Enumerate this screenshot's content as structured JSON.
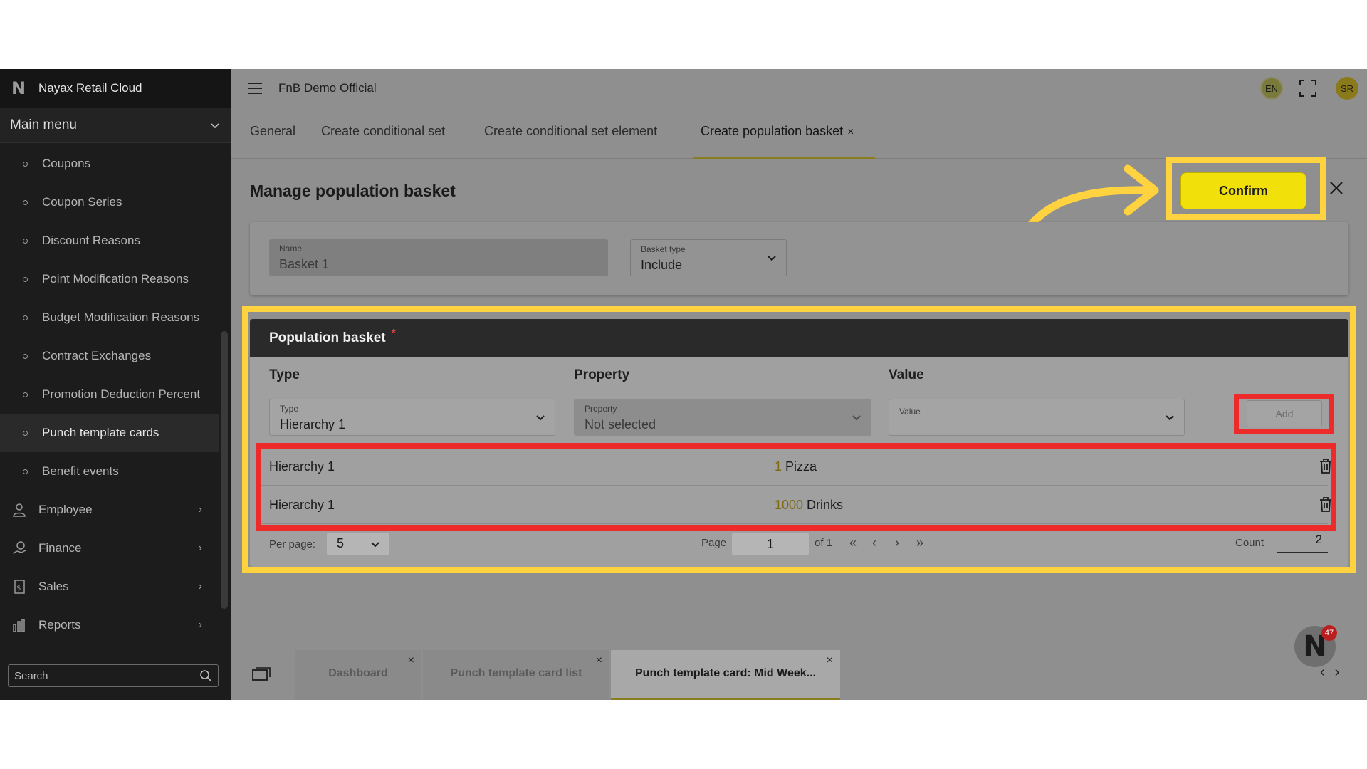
{
  "sidebar": {
    "brand": "Nayax Retail Cloud",
    "main_menu": "Main menu",
    "items": [
      {
        "label": "Coupons"
      },
      {
        "label": "Coupon Series"
      },
      {
        "label": "Discount Reasons"
      },
      {
        "label": "Point Modification Reasons"
      },
      {
        "label": "Budget Modification Reasons"
      },
      {
        "label": "Contract Exchanges"
      },
      {
        "label": "Promotion Deduction Percent"
      },
      {
        "label": "Punch template cards",
        "active": true
      },
      {
        "label": "Benefit events"
      }
    ],
    "groups": [
      {
        "label": "Employee",
        "icon": "person-icon"
      },
      {
        "label": "Finance",
        "icon": "money-hand-icon"
      },
      {
        "label": "Sales",
        "icon": "receipt-dollar-icon"
      },
      {
        "label": "Reports",
        "icon": "bar-chart-icon"
      }
    ],
    "search_placeholder": "Search"
  },
  "topbar": {
    "org": "FnB Demo Official",
    "lang": "EN",
    "avatar": "SR"
  },
  "tabs": [
    {
      "label": "General"
    },
    {
      "label": "Create conditional set"
    },
    {
      "label": "Create conditional set element"
    },
    {
      "label": "Create population basket",
      "active": true,
      "closable": true
    }
  ],
  "page": {
    "title": "Manage population basket",
    "confirm": "Confirm",
    "name_label": "Name",
    "name_value": "Basket 1",
    "basket_type_label": "Basket type",
    "basket_type_value": "Include"
  },
  "basket": {
    "header": "Population basket",
    "required_mark": "*",
    "columns": [
      "Type",
      "Property",
      "Value"
    ],
    "type_label": "Type",
    "type_value": "Hierarchy 1",
    "property_label": "Property",
    "property_value": "Not selected",
    "value_label": "Value",
    "add": "Add",
    "rows": [
      {
        "type": "Hierarchy 1",
        "value_num": "1",
        "value_text": " Pizza"
      },
      {
        "type": "Hierarchy 1",
        "value_num": "1000",
        "value_text": " Drinks"
      }
    ],
    "pager": {
      "per_page_label": "Per page:",
      "per_page": "5",
      "page_label": "Page",
      "page": "1",
      "of": "of 1",
      "count_label": "Count",
      "count": "2"
    }
  },
  "bottom_tabs": [
    {
      "label": "Dashboard"
    },
    {
      "label": "Punch template card list"
    },
    {
      "label": "Punch template card: Mid Week...",
      "active": true
    }
  ],
  "assistant": {
    "badge": "47"
  },
  "colors": {
    "accent": "#f2e00a",
    "highlight": "#ffd23f",
    "annotation_red": "#ee2b2b"
  }
}
